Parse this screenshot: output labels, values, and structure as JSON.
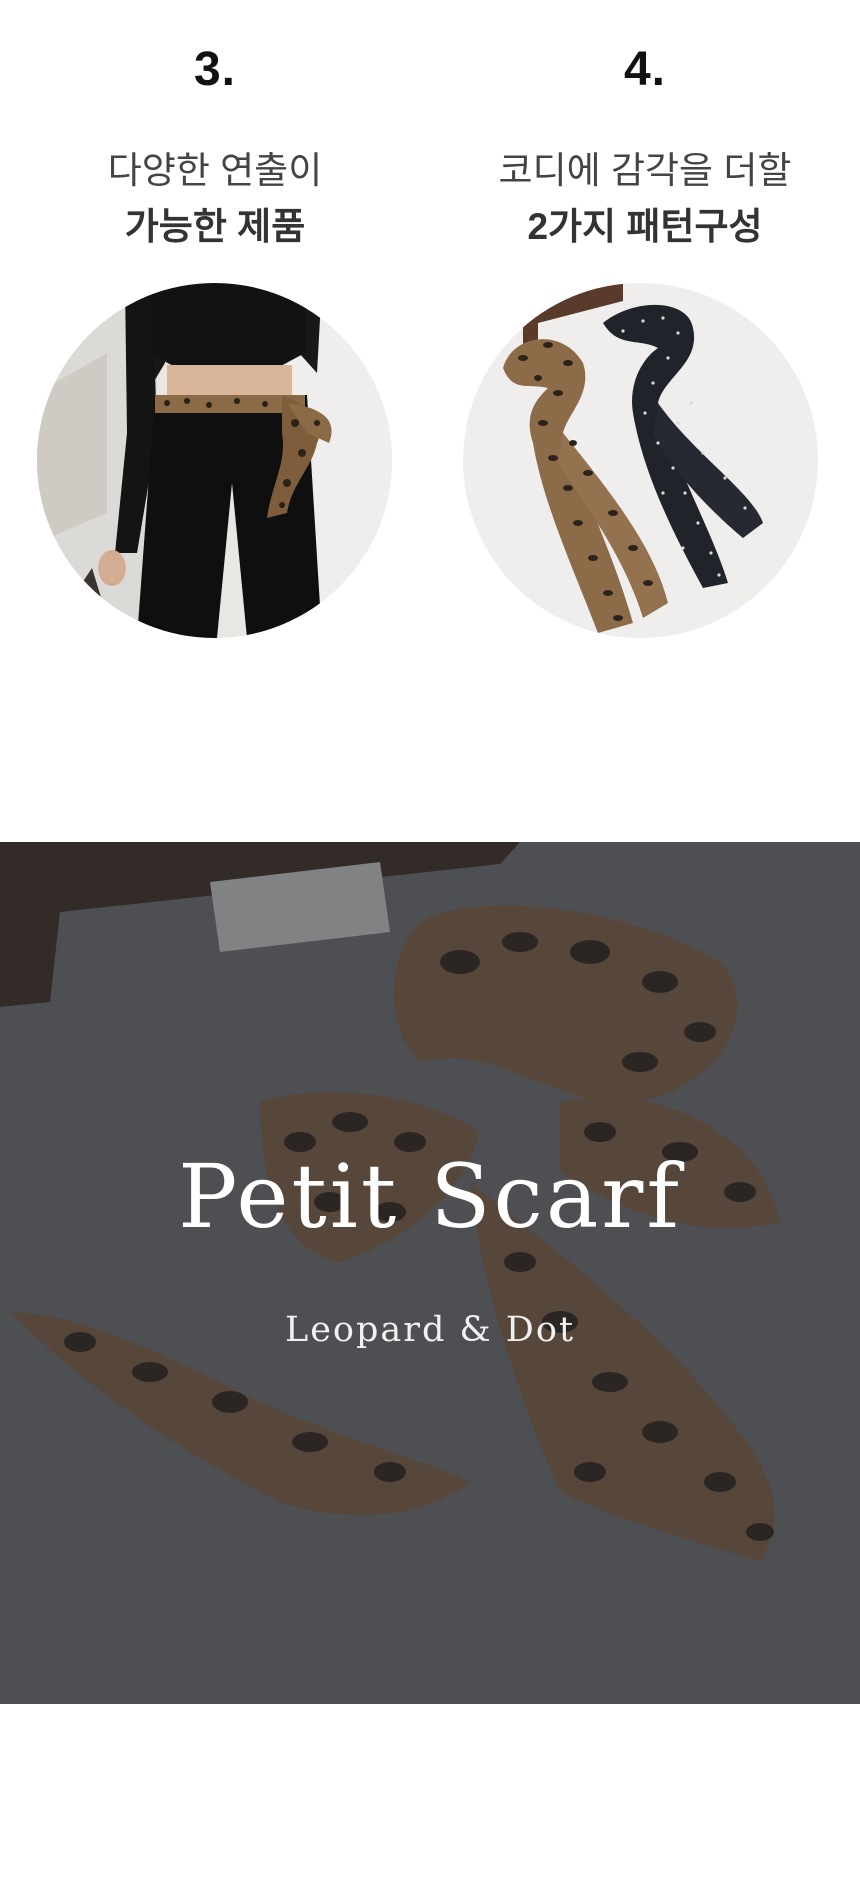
{
  "features": [
    {
      "number": "3.",
      "line1": "다양한 연출이",
      "line2": "가능한 제품",
      "image_icon": "model-wearing-scarf-belt-photo"
    },
    {
      "number": "4.",
      "line1": "코디에 감각을 더할",
      "line2": "2가지 패턴구성",
      "image_icon": "leopard-and-dot-scarves-photo"
    }
  ],
  "hero": {
    "title": "Petit Scarf",
    "subtitle": "Leopard & Dot",
    "image_icon": "leopard-scarf-bow-photo"
  },
  "colors": {
    "text_dark": "#111111",
    "text_body": "#444444",
    "hero_overlay": "#3a3c40",
    "leopard_base": "#8a6a48",
    "leopard_spot": "#2b2219",
    "dot_scarf": "#22252c"
  }
}
